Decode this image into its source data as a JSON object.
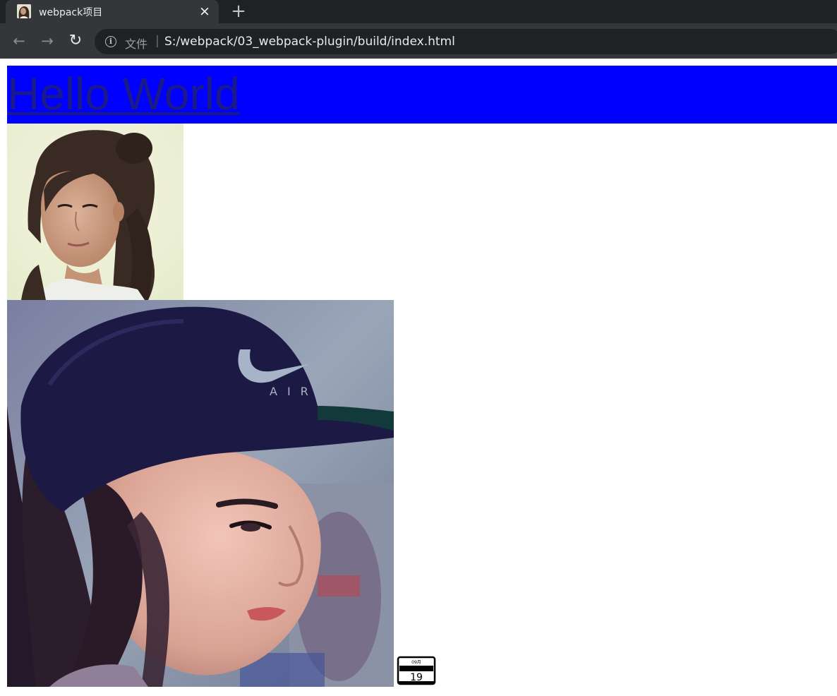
{
  "browser": {
    "tab": {
      "title": "webpack项目",
      "favicon": "portrait-favicon",
      "close_icon": "×"
    },
    "new_tab_icon": "+",
    "nav": {
      "back_icon": "←",
      "forward_icon": "→",
      "reload_icon": "↻"
    },
    "omnibox": {
      "info_icon": "i",
      "label": "文件",
      "separator": "|",
      "url": "S:/webpack/03_webpack-plugin/build/index.html"
    },
    "colors": {
      "tabstrip": "#202124",
      "toolbar": "#35363a",
      "omnibox": "#202124"
    }
  },
  "page": {
    "hello_link": "Hello World",
    "hello_bar_color": "#0000ff",
    "hello_link_color": "#1a1a88",
    "images": [
      {
        "name": "portrait-photo-small",
        "icon": "woman-portrait-image"
      },
      {
        "name": "portrait-photo-large",
        "icon": "woman-in-cap-portrait-image"
      },
      {
        "name": "calendar-image",
        "icon": "calendar-icon"
      }
    ],
    "calendar": {
      "header": "09月",
      "day": "19"
    }
  }
}
